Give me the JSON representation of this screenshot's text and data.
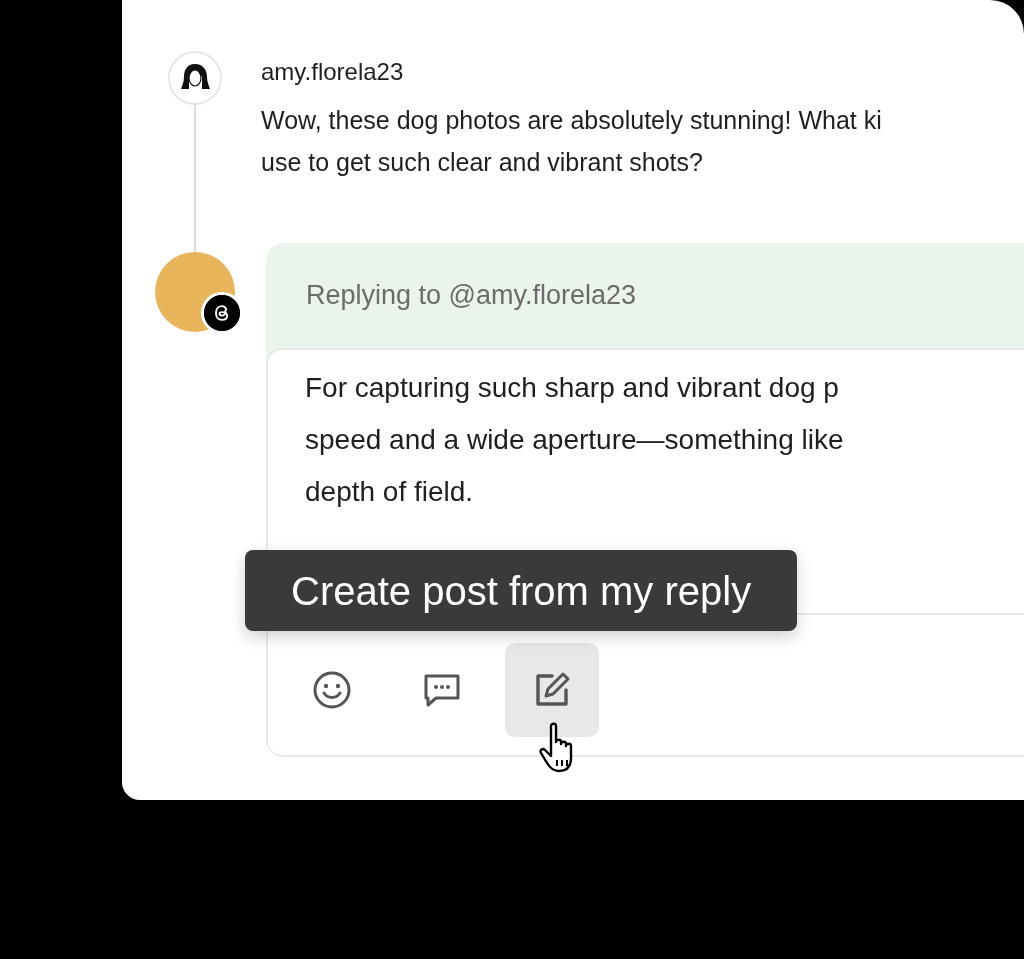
{
  "comment": {
    "username": "amy.florela23",
    "lines": [
      "Wow, these dog photos are absolutely stunning! What ki",
      "use to get such clear and vibrant shots?"
    ]
  },
  "reply": {
    "replying_to": "Replying to @amy.florela23",
    "lines": [
      "For capturing such sharp and vibrant dog p",
      "speed and a wide aperture—something like",
      "depth of field."
    ],
    "actions": [
      {
        "kind": "emoji",
        "highlighted": false
      },
      {
        "kind": "comment",
        "highlighted": false
      },
      {
        "kind": "edit",
        "highlighted": true
      }
    ],
    "tooltip": "Create post from my reply"
  }
}
